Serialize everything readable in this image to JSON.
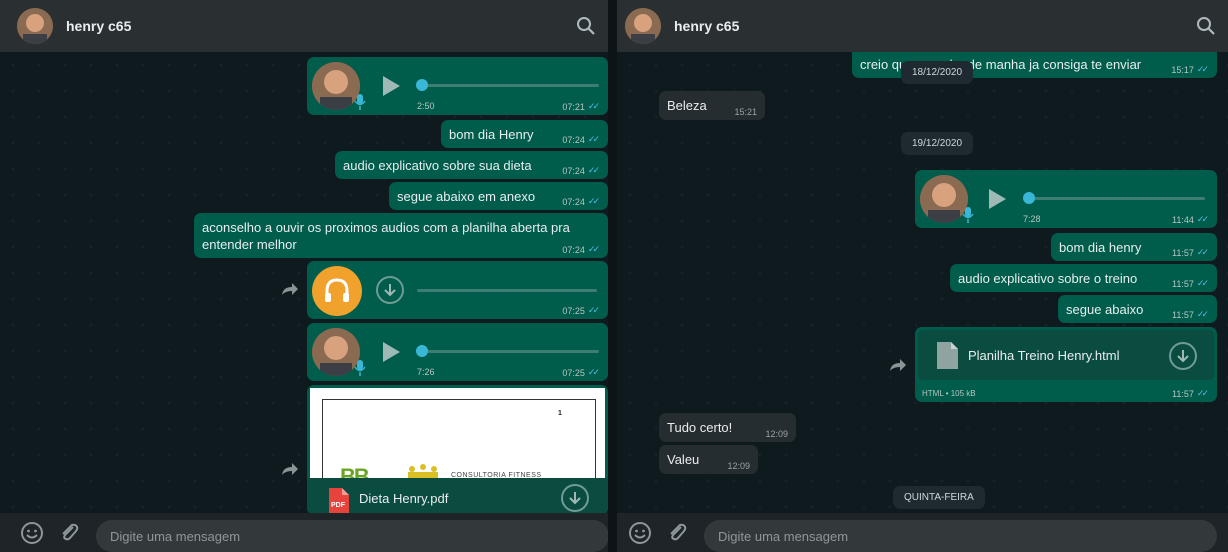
{
  "contact_name": "henry c65",
  "input_placeholder": "Digite uma mensagem",
  "colors": {
    "outgoing": "#005c4b",
    "incoming": "#262d31",
    "tick": "#53bdeb",
    "headphones": "#f0a22c"
  },
  "left": {
    "voice1": {
      "duration": "2:50",
      "time": "07:21"
    },
    "m1": {
      "text": "bom dia Henry",
      "time": "07:24"
    },
    "m2": {
      "text": "audio explicativo sobre sua dieta",
      "time": "07:24"
    },
    "m3": {
      "text": "segue abaixo em anexo",
      "time": "07:24"
    },
    "m4": {
      "text": "aconselho a ouvir os proximos audios com a planilha aberta pra entender melhor",
      "time": "07:24"
    },
    "audio": {
      "time": "07:25"
    },
    "voice2": {
      "duration": "7:26",
      "time": "07:25"
    },
    "doc": {
      "page_number": "1",
      "brand": "CONSULTORIA FITNESS",
      "file_name": "Dieta Henry.pdf",
      "file_type": "PDF"
    }
  },
  "right": {
    "m0": {
      "text": "creio que amanha de manha ja consiga te enviar",
      "time": "15:17"
    },
    "date1": "18/12/2020",
    "in1": {
      "text": "Beleza",
      "time": "15:21"
    },
    "date2": "19/12/2020",
    "voice": {
      "duration": "7:28",
      "time": "11:44"
    },
    "m1": {
      "text": "bom dia henry",
      "time": "11:57"
    },
    "m2": {
      "text": "audio explicativo sobre o treino",
      "time": "11:57"
    },
    "m3": {
      "text": "segue abaixo",
      "time": "11:57"
    },
    "file": {
      "name": "Planilha Treino Henry.html",
      "meta": "HTML • 105 kB",
      "time": "11:57"
    },
    "in2": {
      "text": "Tudo certo!",
      "time": "12:09"
    },
    "in3": {
      "text": "Valeu",
      "time": "12:09"
    },
    "date3": "QUINTA-FEIRA"
  }
}
